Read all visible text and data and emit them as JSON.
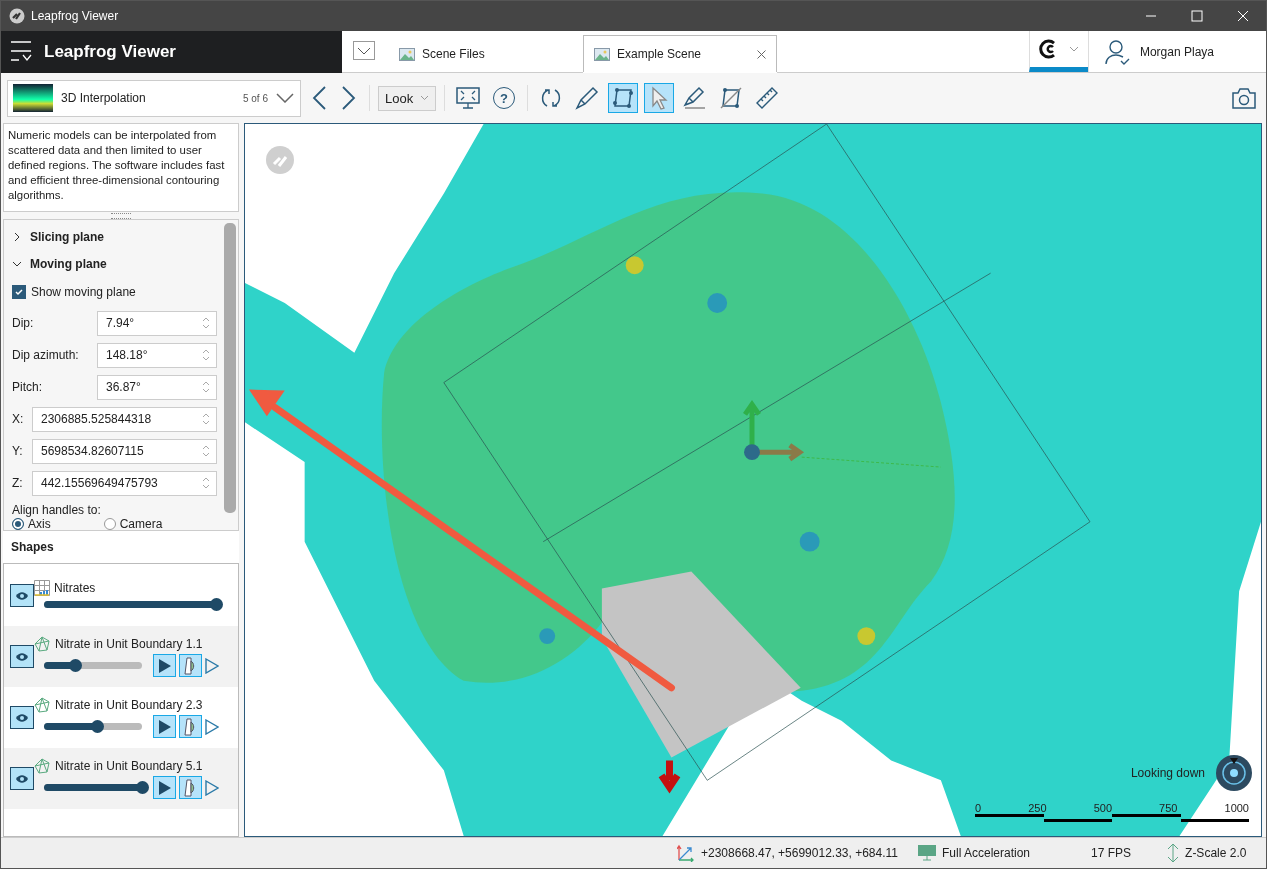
{
  "window": {
    "title": "Leapfrog Viewer"
  },
  "header": {
    "app_title": "Leapfrog Viewer",
    "tabs": [
      {
        "label": "Scene Files",
        "selected": false
      },
      {
        "label": "Example Scene",
        "selected": true
      }
    ],
    "user_name": "Morgan Playa"
  },
  "scene_selector": {
    "title": "3D Interpolation",
    "counter": "5 of 6"
  },
  "view_mode": "Look",
  "toolbar": {
    "tools": [
      {
        "kind": "fit",
        "selected": false
      },
      {
        "kind": "help",
        "glyph": "?",
        "selected": false
      },
      {
        "kind": "rotate",
        "selected": false
      },
      {
        "kind": "slice",
        "selected": false
      },
      {
        "kind": "plane",
        "selected": true
      },
      {
        "kind": "pointer",
        "selected": true
      },
      {
        "kind": "slicer",
        "selected": false
      },
      {
        "kind": "plane-off",
        "selected": false
      },
      {
        "kind": "ruler",
        "selected": false
      }
    ]
  },
  "description": "Numeric models can be interpolated from scattered data and then limited to user defined regions. The software includes fast and efficient three-dimensional contouring algorithms.",
  "properties": {
    "sections": [
      {
        "label": "Slicing plane",
        "expanded": false
      },
      {
        "label": "Moving plane",
        "expanded": true
      }
    ],
    "show_moving_plane": {
      "label": "Show moving plane",
      "checked": true
    },
    "fields": [
      {
        "label": "Dip:",
        "value": "7.94°",
        "kind": "short"
      },
      {
        "label": "Dip azimuth:",
        "value": "148.18°",
        "kind": "short"
      },
      {
        "label": "Pitch:",
        "value": "36.87°",
        "kind": "short"
      },
      {
        "label": "X:",
        "value": "2306885.525844318",
        "kind": "long"
      },
      {
        "label": "Y:",
        "value": "5698534.82607115",
        "kind": "long"
      },
      {
        "label": "Z:",
        "value": "442.15569649475793",
        "kind": "long"
      }
    ],
    "align": {
      "label": "Align handles to:",
      "options": [
        {
          "label": "Axis",
          "selected": true
        },
        {
          "label": "Camera",
          "selected": false
        }
      ]
    }
  },
  "shapes": {
    "title": "Shapes",
    "items": [
      {
        "name": "Nitrates",
        "kind": "points",
        "visible": true,
        "level": 1.0
      },
      {
        "name": "Nitrate in Unit Boundary 1.1",
        "kind": "mesh",
        "visible": true,
        "level": 0.32
      },
      {
        "name": "Nitrate in Unit Boundary 2.3",
        "kind": "mesh",
        "visible": true,
        "level": 0.55
      },
      {
        "name": "Nitrate in Unit Boundary 5.1",
        "kind": "mesh",
        "visible": true,
        "level": 1.0
      }
    ]
  },
  "viewport": {
    "orientation": "Looking down",
    "scale_labels": [
      "0",
      "250",
      "500",
      "750",
      "1000"
    ]
  },
  "status_bar": {
    "coordinates": "+2308668.47, +5699012.33, +684.11",
    "acceleration": "Full Acceleration",
    "fps": "17 FPS",
    "z_scale": "Z-Scale 2.0"
  }
}
